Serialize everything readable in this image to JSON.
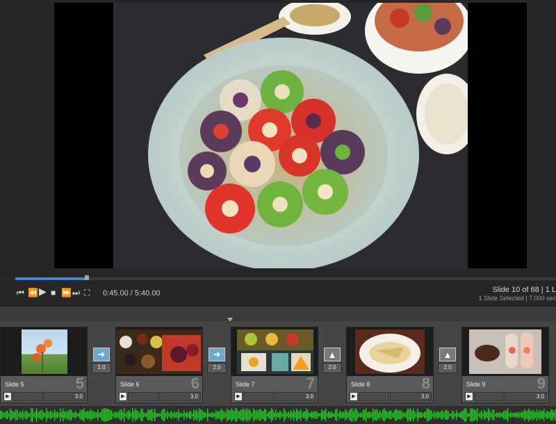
{
  "player": {
    "time": "0:45.00 / 5:40.00",
    "slide_counter": "Slide 10 of 68  |  1 L",
    "selection_info": "1 Slide Selected  |  7.000 sec",
    "progress_fraction": 0.133
  },
  "controls": {
    "icons": [
      "skip-to-start-icon",
      "rewind-icon",
      "play-icon",
      "stop-icon",
      "fast-forward-icon",
      "skip-to-end-icon",
      "fullscreen-icon"
    ]
  },
  "slides": [
    {
      "name": "Slide 5",
      "number": "5",
      "duration": "3.0"
    },
    {
      "name": "Slide 6",
      "number": "6",
      "duration": "3.0"
    },
    {
      "name": "Slide 7",
      "number": "7",
      "duration": "3.0"
    },
    {
      "name": "Slide 8",
      "number": "8",
      "duration": "3.0"
    },
    {
      "name": "Slide 9",
      "number": "9",
      "duration": "3.0"
    }
  ],
  "transitions": [
    {
      "icon": "arrow-right-icon",
      "duration": "2.0"
    },
    {
      "icon": "arrow-right-icon",
      "duration": "2.0"
    },
    {
      "icon": "mountain-transition-icon",
      "duration": "2.0"
    },
    {
      "icon": "mountain-transition-icon",
      "duration": "2.0"
    }
  ],
  "colors": {
    "accent": "#3f86d8",
    "waveform": "#3fbf3f"
  }
}
